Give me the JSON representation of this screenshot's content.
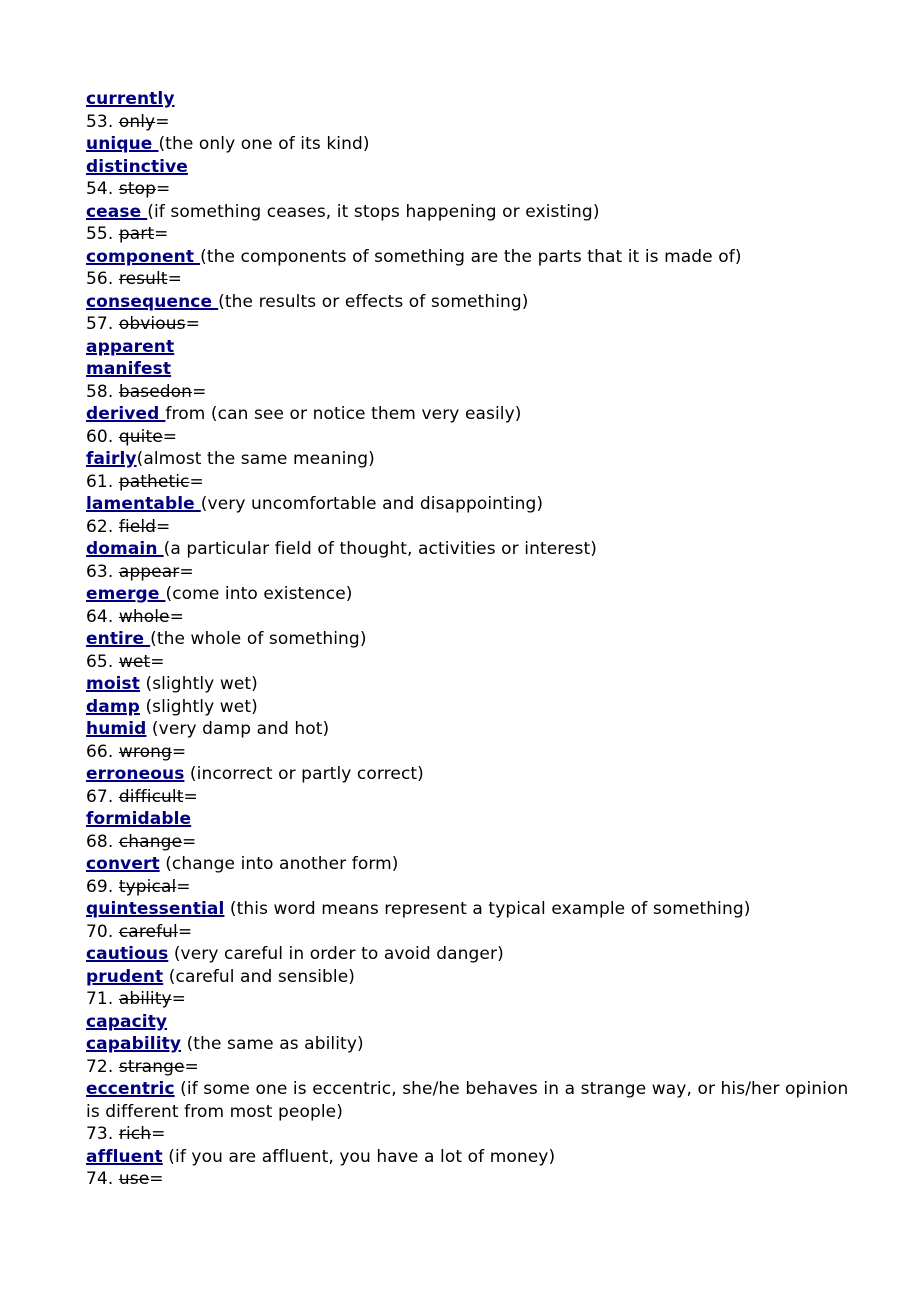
{
  "document": {
    "type": "vocabulary-synonym-list",
    "accent_color": "#000080",
    "text_color": "#000000",
    "background_color": "#ffffff",
    "lines": [
      {
        "kind": "synonym",
        "head": "currently",
        "gloss": ""
      },
      {
        "kind": "numbered",
        "index": "53.",
        "word": "only",
        "equals": "="
      },
      {
        "kind": "synonym",
        "head": "unique ",
        "gloss": "(the only one of its kind)"
      },
      {
        "kind": "synonym",
        "head": "distinctive",
        "gloss": ""
      },
      {
        "kind": "numbered",
        "index": "54.",
        "word": "stop",
        "equals": "="
      },
      {
        "kind": "synonym",
        "head": "cease ",
        "gloss": "(if something ceases, it stops happening or existing)"
      },
      {
        "kind": "numbered",
        "index": "55.",
        "word": "part",
        "equals": "="
      },
      {
        "kind": "synonym",
        "head": "component ",
        "gloss": "(the components of something are the parts that it is made of)"
      },
      {
        "kind": "numbered",
        "index": "56.",
        "word": "result",
        "equals": "="
      },
      {
        "kind": "synonym",
        "head": "consequence ",
        "gloss": "(the results or effects of something)"
      },
      {
        "kind": "numbered",
        "index": "57.",
        "word": "obvious",
        "equals": "="
      },
      {
        "kind": "synonym",
        "head": "apparent",
        "gloss": ""
      },
      {
        "kind": "synonym",
        "head": "manifest",
        "gloss": ""
      },
      {
        "kind": "numbered",
        "index": "58.",
        "word": "basedon",
        "equals": "="
      },
      {
        "kind": "synonym",
        "head": "derived ",
        "gloss": "from (can see or notice them very easily)"
      },
      {
        "kind": "numbered",
        "index": "60.",
        "word": "quite",
        "equals": "="
      },
      {
        "kind": "synonym",
        "head": "fairly",
        "gloss": "(almost the same meaning)"
      },
      {
        "kind": "numbered",
        "index": "61.",
        "word": "pathetic",
        "equals": "="
      },
      {
        "kind": "synonym",
        "head": "lamentable ",
        "gloss": "(very uncomfortable and disappointing)"
      },
      {
        "kind": "numbered",
        "index": "62.",
        "word": "field",
        "equals": "="
      },
      {
        "kind": "synonym",
        "head": "domain ",
        "gloss": "(a particular field of thought, activities or interest)"
      },
      {
        "kind": "numbered",
        "index": "63.",
        "word": "appear",
        "equals": "="
      },
      {
        "kind": "synonym",
        "head": "emerge ",
        "gloss": "(come into existence)"
      },
      {
        "kind": "numbered",
        "index": "64.",
        "word": "whole",
        "equals": "="
      },
      {
        "kind": "synonym",
        "head": "entire ",
        "gloss": "(the whole of something)"
      },
      {
        "kind": "numbered",
        "index": "65.",
        "word": "wet",
        "equals": "="
      },
      {
        "kind": "synonym",
        "head": "moist",
        "gloss": " (slightly wet)"
      },
      {
        "kind": "synonym",
        "head": "damp",
        "gloss": " (slightly wet)"
      },
      {
        "kind": "synonym",
        "head": "humid",
        "gloss": " (very damp and hot)"
      },
      {
        "kind": "numbered",
        "index": "66.",
        "word": "wrong",
        "equals": "="
      },
      {
        "kind": "synonym",
        "head": "erroneous",
        "gloss": " (incorrect or partly correct)"
      },
      {
        "kind": "numbered",
        "index": "67.",
        "word": "difficult",
        "equals": "="
      },
      {
        "kind": "synonym",
        "head": "formidable",
        "gloss": ""
      },
      {
        "kind": "numbered",
        "index": "68.",
        "word": "change",
        "equals": "="
      },
      {
        "kind": "synonym",
        "head": "convert",
        "gloss": " (change into another form)"
      },
      {
        "kind": "numbered",
        "index": "69.",
        "word": "typical",
        "equals": "="
      },
      {
        "kind": "synonym",
        "head": "quintessential",
        "gloss": " (this word means represent a typical example of something)"
      },
      {
        "kind": "numbered",
        "index": "70.",
        "word": "careful",
        "equals": "="
      },
      {
        "kind": "synonym",
        "head": "cautious",
        "gloss": " (very careful in order to avoid danger)"
      },
      {
        "kind": "synonym",
        "head": "prudent",
        "gloss": " (careful and sensible)"
      },
      {
        "kind": "numbered",
        "index": "71.",
        "word": "ability",
        "equals": "="
      },
      {
        "kind": "synonym",
        "head": "capacity",
        "gloss": ""
      },
      {
        "kind": "synonym",
        "head": "capability",
        "gloss": " (the same as ability)"
      },
      {
        "kind": "numbered",
        "index": "72.",
        "word": "strange",
        "equals": "="
      },
      {
        "kind": "synonym",
        "head": "eccentric",
        "gloss": " (if some one is eccentric, she/he behaves in a strange way, or his/her opinion is different from most people)"
      },
      {
        "kind": "numbered",
        "index": "73.",
        "word": "rich",
        "equals": "="
      },
      {
        "kind": "synonym",
        "head": "affluent",
        "gloss": " (if you are affluent, you have a lot of money)"
      },
      {
        "kind": "numbered",
        "index": "74.",
        "word": "use",
        "equals": "="
      }
    ]
  }
}
